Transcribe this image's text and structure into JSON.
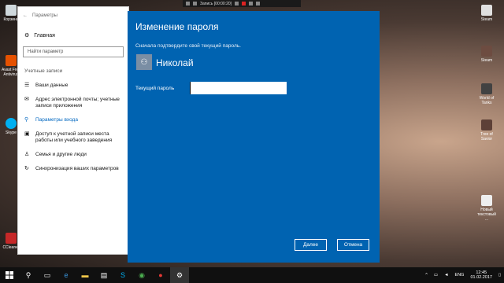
{
  "recorder": {
    "label": "Запись [00:00:20]"
  },
  "settings": {
    "title": "Параметры",
    "home": "Главная",
    "search_placeholder": "Найти параметр",
    "section": "Учетные записи",
    "nav": [
      {
        "label": "Ваши данные",
        "icon": "person-card-icon"
      },
      {
        "label": "Адрес электронной почты; учетные записи приложения",
        "icon": "mail-icon"
      },
      {
        "label": "Параметры входа",
        "icon": "key-icon"
      },
      {
        "label": "Доступ к учетной записи места работы или учебного заведения",
        "icon": "briefcase-icon"
      },
      {
        "label": "Семья и другие люди",
        "icon": "people-icon"
      },
      {
        "label": "Синхронизация ваших параметров",
        "icon": "sync-icon"
      }
    ]
  },
  "dialog": {
    "title": "Изменение пароля",
    "subtitle": "Сначала подтвердите свой текущий пароль.",
    "user_name": "Николай",
    "password_label": "Текущий пароль",
    "password_value": "",
    "next_label": "Далее",
    "cancel_label": "Отмена"
  },
  "desktop": {
    "left_icons": [
      "Корзина",
      "",
      "Avast Free Antivirus",
      "",
      "Skype",
      "",
      "",
      "CCleaner"
    ],
    "right_icons": [
      "Steam",
      "Steam",
      "World of Tanks",
      "Tree of Savior",
      "Новый текстовый ..."
    ]
  },
  "taskbar": {
    "time": "12:45",
    "date": "01.02.2017",
    "lang": "ENG"
  },
  "colors": {
    "dialog_bg": "#0063b1",
    "accent": "#0067c0"
  }
}
